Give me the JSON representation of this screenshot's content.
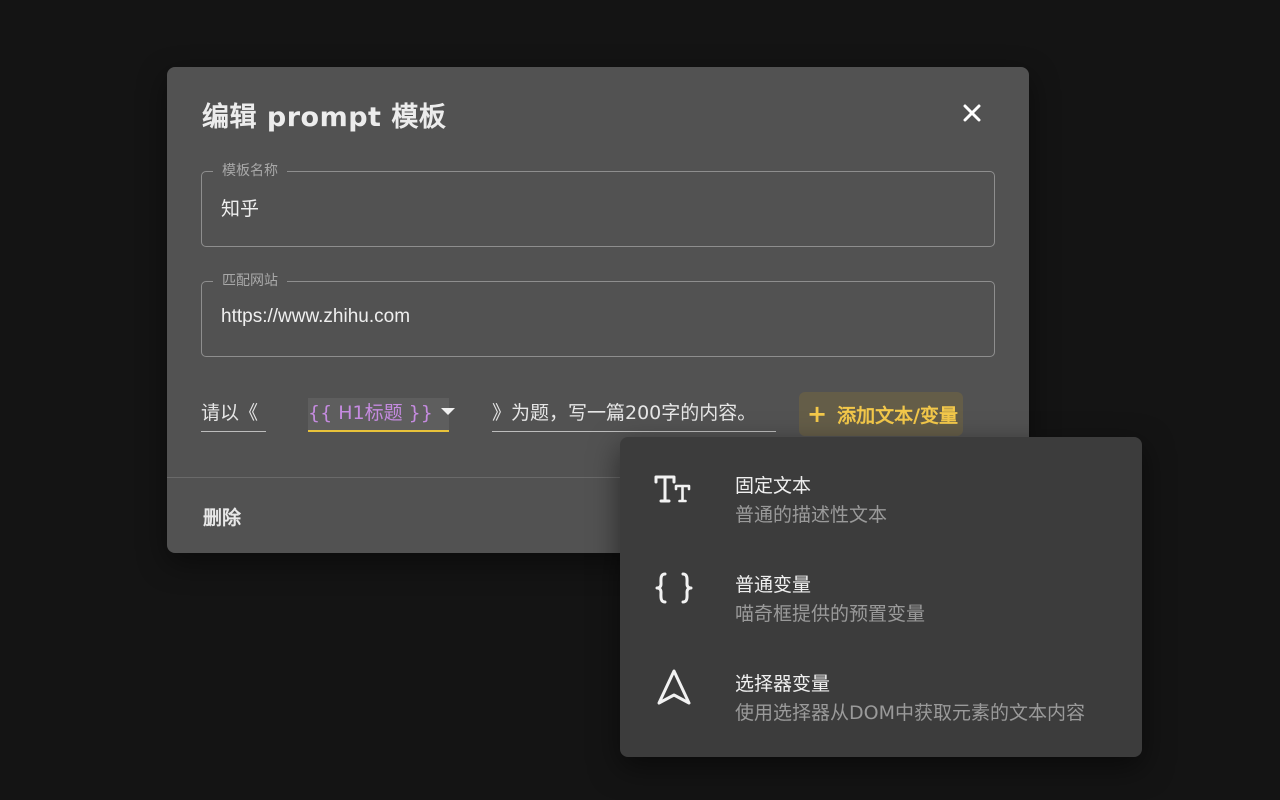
{
  "dialog": {
    "title": "编辑 prompt 模板",
    "close_icon": "close-icon",
    "fields": {
      "name": {
        "label": "模板名称",
        "value": "知乎"
      },
      "site": {
        "label": "匹配网站",
        "value": "https://www.zhihu.com"
      }
    },
    "segments": {
      "prefix": "请以《",
      "variable": "{{ H1标题 }}",
      "suffix": "》为题，写一篇200字的内容。"
    },
    "add_button": {
      "icon": "plus-icon",
      "label": "添加文本/变量"
    },
    "delete_label": "删除"
  },
  "menu": {
    "items": [
      {
        "icon": "text-format-icon",
        "title": "固定文本",
        "desc": "普通的描述性文本"
      },
      {
        "icon": "braces-icon",
        "title": "普通变量",
        "desc": "喵奇框提供的预置变量"
      },
      {
        "icon": "navigation-arrow-icon",
        "title": "选择器变量",
        "desc": "使用选择器从DOM中获取元素的文本内容"
      }
    ]
  },
  "colors": {
    "background": "#141414",
    "dialog": "#525252",
    "menu": "#3c3c3c",
    "accent": "#f3c84a",
    "variable": "#c58be0"
  }
}
